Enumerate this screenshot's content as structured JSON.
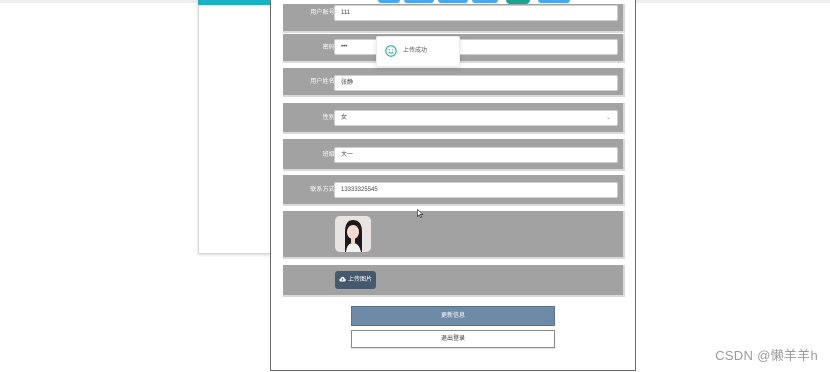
{
  "form": {
    "account": {
      "label": "用户账号",
      "value": "111"
    },
    "password": {
      "label": "密码",
      "value": "•••"
    },
    "username": {
      "label": "用户姓名",
      "value": "张静"
    },
    "gender": {
      "label": "性别",
      "value": "女",
      "arrow": "⌄"
    },
    "grade": {
      "label": "班级",
      "value": "大一"
    },
    "contact": {
      "label": "联系方式",
      "value": "13333325545"
    }
  },
  "upload_button": {
    "label": "上传图片"
  },
  "update_button": {
    "label": "更新信息"
  },
  "logout_button": {
    "label": "退出登录"
  },
  "toast": {
    "message": "上传成功",
    "icon": "smile-icon"
  },
  "watermark": "CSDN @懒羊羊h",
  "colors": {
    "row_bg": "#a2a2a2",
    "update_btn": "#6d8ba6",
    "upload_btn": "#44586e",
    "toast_icon": "#1aa592",
    "accent_top": "#17b3c4"
  }
}
